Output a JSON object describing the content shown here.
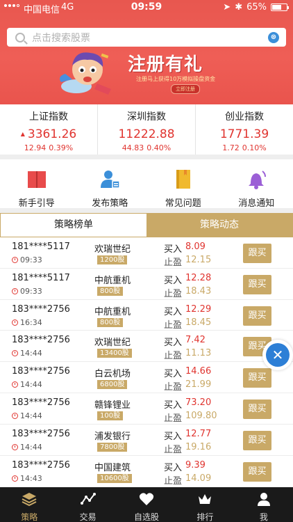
{
  "status_bar": {
    "carrier": "中国电信",
    "network": "4G",
    "time": "09:59",
    "battery": "65%",
    "battery_level": 0.65
  },
  "search": {
    "placeholder": "点击搜索股票"
  },
  "banner": {
    "title": "注册有礼",
    "subtitle": "注册马上获得10万模拟操盘资金",
    "button": "立即注册"
  },
  "indices": [
    {
      "name": "上证指数",
      "value": "3361.26",
      "change": "12.94",
      "percent": "0.39%"
    },
    {
      "name": "深圳指数",
      "value": "11222.88",
      "change": "44.83",
      "percent": "0.40%"
    },
    {
      "name": "创业指数",
      "value": "1771.39",
      "change": "1.72",
      "percent": "0.10%"
    }
  ],
  "features": [
    {
      "label": "新手引导",
      "icon": "book-icon",
      "color": "#e84b4b"
    },
    {
      "label": "发布策略",
      "icon": "user-card-icon",
      "color": "#3b8fd9"
    },
    {
      "label": "常见问题",
      "icon": "notebook-icon",
      "color": "#f0b92e"
    },
    {
      "label": "消息通知",
      "icon": "bell-icon",
      "color": "#9b5fd6"
    }
  ],
  "tabs": [
    {
      "label": "策略榜单"
    },
    {
      "label": "策略动态"
    }
  ],
  "strategy_rows": [
    {
      "user": "181****5117",
      "time": "09:33",
      "stock": "欢瑞世纪",
      "shares": "1200股",
      "buy_label": "买入",
      "buy_price": "8.09",
      "tp_label": "止盈",
      "take_profit": "12.15",
      "action": "跟买"
    },
    {
      "user": "181****5117",
      "time": "09:33",
      "stock": "中航重机",
      "shares": "800股",
      "buy_label": "买入",
      "buy_price": "12.28",
      "tp_label": "止盈",
      "take_profit": "18.43",
      "action": "跟买"
    },
    {
      "user": "183****2756",
      "time": "16:34",
      "stock": "中航重机",
      "shares": "800股",
      "buy_label": "买入",
      "buy_price": "12.29",
      "tp_label": "止盈",
      "take_profit": "18.45",
      "action": "跟买"
    },
    {
      "user": "183****2756",
      "time": "14:44",
      "stock": "欢瑞世纪",
      "shares": "13400股",
      "buy_label": "买入",
      "buy_price": "7.42",
      "tp_label": "止盈",
      "take_profit": "11.13",
      "action": "跟买"
    },
    {
      "user": "183****2756",
      "time": "14:44",
      "stock": "白云机场",
      "shares": "6800股",
      "buy_label": "买入",
      "buy_price": "14.66",
      "tp_label": "止盈",
      "take_profit": "21.99",
      "action": "跟买"
    },
    {
      "user": "183****2756",
      "time": "14:44",
      "stock": "赣锋锂业",
      "shares": "100股",
      "buy_label": "买入",
      "buy_price": "73.20",
      "tp_label": "止盈",
      "take_profit": "109.80",
      "action": "跟买"
    },
    {
      "user": "183****2756",
      "time": "14:44",
      "stock": "浦发银行",
      "shares": "7800股",
      "buy_label": "买入",
      "buy_price": "12.77",
      "tp_label": "止盈",
      "take_profit": "19.16",
      "action": "跟买"
    },
    {
      "user": "183****2756",
      "time": "14:43",
      "stock": "中国建筑",
      "shares": "10600股",
      "buy_label": "买入",
      "buy_price": "9.39",
      "tp_label": "止盈",
      "take_profit": "14.09",
      "action": "跟买"
    }
  ],
  "bottom_nav": [
    {
      "label": "策略",
      "icon": "layers-icon"
    },
    {
      "label": "交易",
      "icon": "trend-line-icon"
    },
    {
      "label": "自选股",
      "icon": "heart-icon"
    },
    {
      "label": "排行",
      "icon": "crown-icon"
    },
    {
      "label": "我",
      "icon": "person-icon"
    }
  ],
  "colors": {
    "primary_red": "#e0342f",
    "gold": "#c9a967",
    "nav_bg": "#1a1a1a"
  }
}
